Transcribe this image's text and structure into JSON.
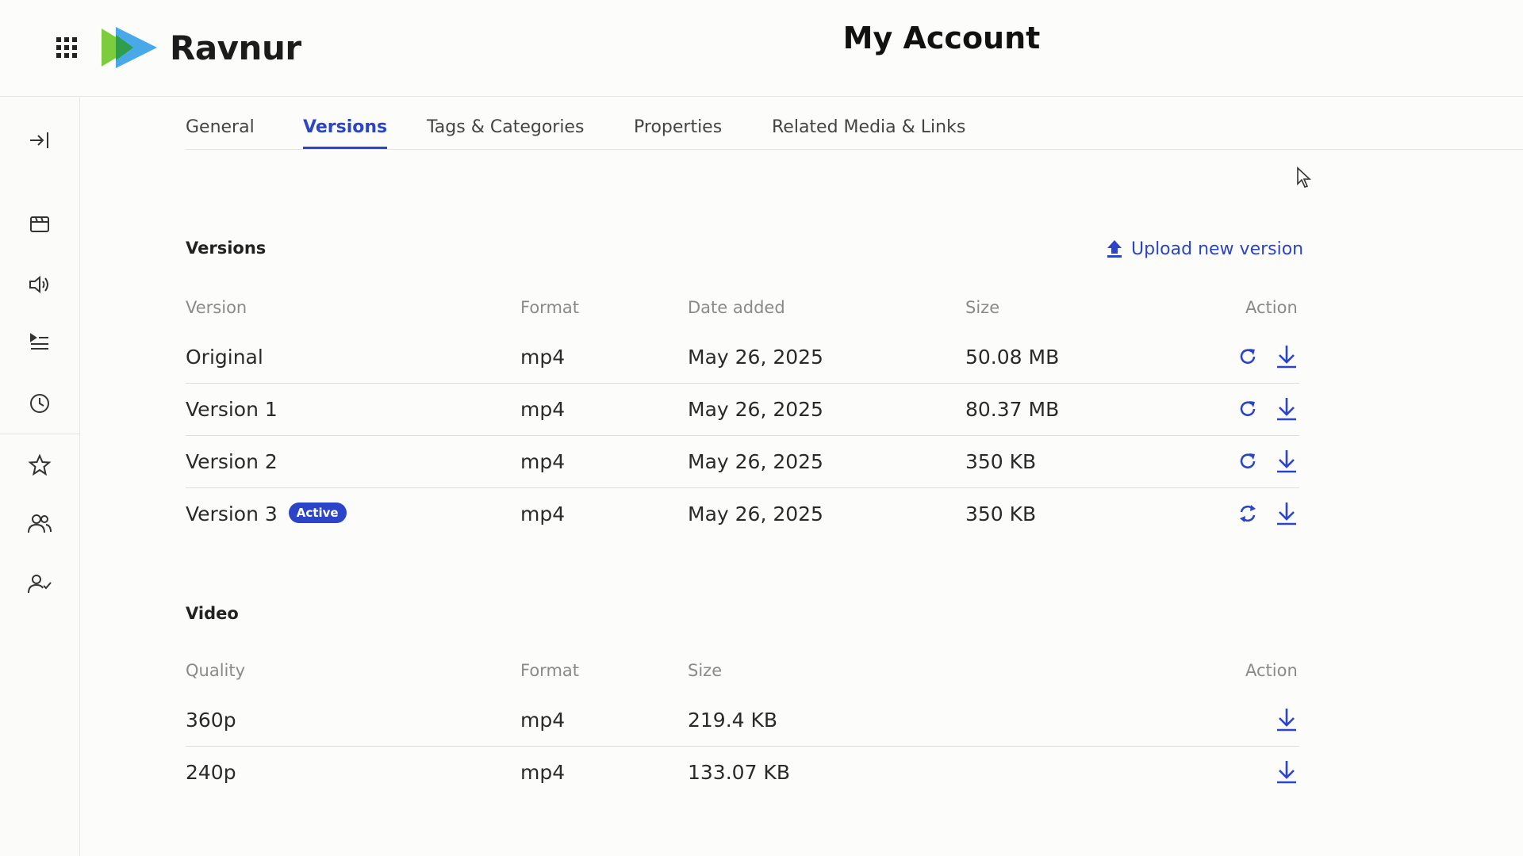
{
  "app": {
    "name": "Ravnur",
    "page_title": "My Account"
  },
  "colors": {
    "accent": "#2b44c8",
    "logo_green": "#7ccc3c",
    "logo_blue": "#3fa3e6"
  },
  "header": {
    "apps_icon": "grid-icon"
  },
  "sidebar": {
    "items": [
      {
        "icon": "collapse-sidebar-icon"
      },
      {
        "icon": "media-library-icon"
      },
      {
        "icon": "audio-icon"
      },
      {
        "icon": "playlist-icon"
      },
      {
        "icon": "history-icon"
      },
      {
        "icon": "favorites-star-icon"
      },
      {
        "icon": "groups-icon"
      },
      {
        "icon": "user-check-icon"
      }
    ]
  },
  "tabs": [
    {
      "label": "General",
      "active": false
    },
    {
      "label": "Versions",
      "active": true
    },
    {
      "label": "Tags & Categories",
      "active": false
    },
    {
      "label": "Properties",
      "active": false
    },
    {
      "label": "Related Media & Links",
      "active": false
    }
  ],
  "versions": {
    "title": "Versions",
    "upload_label": "Upload new version",
    "columns": [
      "Version",
      "Format",
      "Date added",
      "Size",
      "Action"
    ],
    "rows": [
      {
        "version": "Original",
        "format": "mp4",
        "date": "May 26, 2025",
        "size": "50.08 MB",
        "badge": ""
      },
      {
        "version": "Version 1",
        "format": "mp4",
        "date": "May 26, 2025",
        "size": "80.37 MB",
        "badge": ""
      },
      {
        "version": "Version 2",
        "format": "mp4",
        "date": "May 26, 2025",
        "size": "350 KB",
        "badge": ""
      },
      {
        "version": "Version 3",
        "format": "mp4",
        "date": "May 26, 2025",
        "size": "350 KB",
        "badge": "Active"
      }
    ]
  },
  "video": {
    "title": "Video",
    "columns": [
      "Quality",
      "Format",
      "Size",
      "Action"
    ],
    "rows": [
      {
        "quality": "360p",
        "format": "mp4",
        "size": "219.4 KB"
      },
      {
        "quality": "240p",
        "format": "mp4",
        "size": "133.07 KB"
      }
    ]
  }
}
